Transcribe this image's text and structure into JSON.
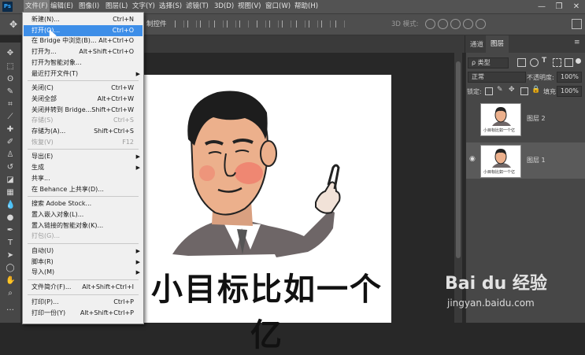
{
  "app": {
    "logo": "Ps"
  },
  "menubar": {
    "items": [
      "文件(F)",
      "编辑(E)",
      "图像(I)",
      "图层(L)",
      "文字(Y)",
      "选择(S)",
      "滤镜(T)",
      "3D(D)",
      "视图(V)",
      "窗口(W)",
      "帮助(H)"
    ]
  },
  "window_controls": {
    "minimize": "—",
    "restore": "❐",
    "close": "✕"
  },
  "options_bar": {
    "text": "制控件",
    "mode_3d": "3D 模式:"
  },
  "file_menu": [
    {
      "label": "新建(N)...",
      "shortcut": "Ctrl+N"
    },
    {
      "label": "打开(O)...",
      "shortcut": "Ctrl+O",
      "highlight": true
    },
    {
      "label": "在 Bridge 中浏览(B)...",
      "shortcut": "Alt+Ctrl+O"
    },
    {
      "label": "打开为...",
      "shortcut": "Alt+Shift+Ctrl+O"
    },
    {
      "label": "打开为智能对象..."
    },
    {
      "label": "最近打开文件(T)",
      "submenu": true,
      "sep_after": true
    },
    {
      "label": "关闭(C)",
      "shortcut": "Ctrl+W"
    },
    {
      "label": "关闭全部",
      "shortcut": "Alt+Ctrl+W"
    },
    {
      "label": "关闭并转到 Bridge...",
      "shortcut": "Shift+Ctrl+W"
    },
    {
      "label": "存储(S)",
      "shortcut": "Ctrl+S",
      "disabled": true
    },
    {
      "label": "存储为(A)...",
      "shortcut": "Shift+Ctrl+S"
    },
    {
      "label": "恢复(V)",
      "shortcut": "F12",
      "disabled": true,
      "sep_after": true
    },
    {
      "label": "导出(E)",
      "submenu": true
    },
    {
      "label": "生成",
      "submenu": true
    },
    {
      "label": "共享..."
    },
    {
      "label": "在 Behance 上共享(D)...",
      "sep_after": true
    },
    {
      "label": "搜索 Adobe Stock..."
    },
    {
      "label": "置入嵌入对象(L)..."
    },
    {
      "label": "置入链接的智能对象(K)..."
    },
    {
      "label": "打包(G)...",
      "disabled": true,
      "sep_after": true
    },
    {
      "label": "自动(U)",
      "submenu": true
    },
    {
      "label": "脚本(R)",
      "submenu": true
    },
    {
      "label": "导入(M)",
      "submenu": true,
      "sep_after": true
    },
    {
      "label": "文件简介(F)...",
      "shortcut": "Alt+Shift+Ctrl+I",
      "sep_after": true
    },
    {
      "label": "打印(P)...",
      "shortcut": "Ctrl+P"
    },
    {
      "label": "打印一份(Y)",
      "shortcut": "Alt+Shift+Ctrl+P"
    }
  ],
  "panel": {
    "tabs": [
      "通道",
      "图层"
    ],
    "active_tab": "图层",
    "filter_kind": "ρ 类型",
    "blend_mode": "正常",
    "opacity_label": "不透明度:",
    "opacity_value": "100%",
    "lock_label": "锁定:",
    "fill_label": "填充:",
    "fill_value": "100%",
    "layers": [
      {
        "name": "图层 2",
        "visible": false
      },
      {
        "name": "图层 1",
        "visible": true,
        "selected": true
      }
    ]
  },
  "document": {
    "caption": "小目标比如一个亿"
  },
  "thumb_caption": "小目标比如一个亿",
  "watermark": {
    "brand": "Bai du 经验",
    "sub": "jingyan.baidu.com"
  },
  "colors": {
    "accent": "#3d8ee8",
    "panel": "#474747",
    "menubar": "#535353",
    "face": "#ecb08c",
    "suit": "#6e6667"
  }
}
